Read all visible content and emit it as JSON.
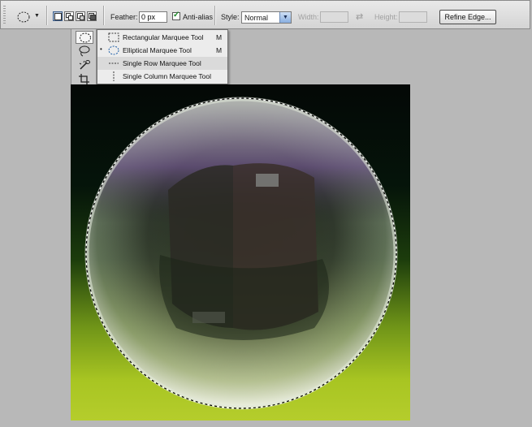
{
  "options_bar": {
    "feather_label": "Feather:",
    "feather_value": "0 px",
    "antialias_label": "Anti-alias",
    "antialias_checked": true,
    "style_label": "Style:",
    "style_value": "Normal",
    "width_label": "Width:",
    "height_label": "Height:",
    "refine_edge_label": "Refine Edge..."
  },
  "flyout_menu": {
    "items": [
      {
        "label": "Rectangular Marquee Tool",
        "shortcut": "M",
        "icon": "rectangle-marquee-icon",
        "selected": false
      },
      {
        "label": "Elliptical Marquee Tool",
        "shortcut": "M",
        "icon": "ellipse-marquee-icon",
        "selected": true
      },
      {
        "label": "Single Row Marquee Tool",
        "shortcut": "",
        "icon": "single-row-marquee-icon",
        "selected": false
      },
      {
        "label": "Single Column Marquee Tool",
        "shortcut": "",
        "icon": "single-column-marquee-icon",
        "selected": false
      }
    ],
    "selected_bullet": "•"
  },
  "tools_panel": [
    "ellipse-marquee-icon",
    "lasso-icon",
    "quick-selection-icon",
    "crop-icon"
  ],
  "colors": {
    "ui_background": "#b8b8b8",
    "options_bar": "#dcdcdc",
    "checkbox_check": "#1e8a2a",
    "canvas_dark": "#040806",
    "canvas_green": "#b5cd2c"
  }
}
